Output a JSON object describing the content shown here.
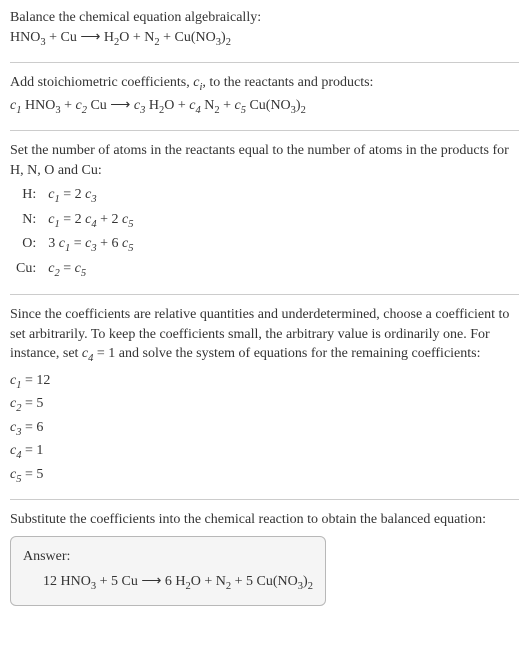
{
  "intro": {
    "line1": "Balance the chemical equation algebraically:",
    "eq_lhs1": "HNO",
    "eq_lhs1_sub": "3",
    "eq_plus1": " + Cu ⟶ H",
    "eq_sub2": "2",
    "eq_mid1": "O + N",
    "eq_sub3": "2",
    "eq_mid2": " + Cu(NO",
    "eq_sub4": "3",
    "eq_close": ")",
    "eq_sub5": "2"
  },
  "stoich": {
    "text_a": "Add stoichiometric coefficients, ",
    "ci": "c",
    "ci_sub": "i",
    "text_b": ", to the reactants and products:",
    "c1": "c",
    "c1s": "1",
    "sp1": " HNO",
    "s1": "3",
    "plus1": " + ",
    "c2": "c",
    "c2s": "2",
    "sp2": " Cu ⟶ ",
    "c3": "c",
    "c3s": "3",
    "sp3": " H",
    "s3": "2",
    "sp3b": "O + ",
    "c4": "c",
    "c4s": "4",
    "sp4": " N",
    "s4": "2",
    "sp4b": " + ",
    "c5": "c",
    "c5s": "5",
    "sp5": " Cu(NO",
    "s5": "3",
    "sp5b": ")",
    "s5c": "2"
  },
  "atoms": {
    "intro": "Set the number of atoms in the reactants equal to the number of atoms in the products for H, N, O and Cu:",
    "rows": [
      {
        "el": "H:",
        "lhs_c": "c",
        "lhs_s": "1",
        "mid": " = 2 ",
        "rhs_c": "c",
        "rhs_s": "3",
        "extra": ""
      },
      {
        "el": "N:",
        "lhs_c": "c",
        "lhs_s": "1",
        "mid": " = 2 ",
        "rhs_c": "c",
        "rhs_s": "4",
        "extra": " + 2 ",
        "rc2": "c",
        "rs2": "5"
      },
      {
        "el": "O:",
        "pre": "3 ",
        "lhs_c": "c",
        "lhs_s": "1",
        "mid": " = ",
        "rhs_c": "c",
        "rhs_s": "3",
        "extra": " + 6 ",
        "rc2": "c",
        "rs2": "5"
      },
      {
        "el": "Cu:",
        "lhs_c": "c",
        "lhs_s": "2",
        "mid": " = ",
        "rhs_c": "c",
        "rhs_s": "5",
        "extra": ""
      }
    ]
  },
  "choose": {
    "para_a": "Since the coefficients are relative quantities and underdetermined, choose a coefficient to set arbitrarily. To keep the coefficients small, the arbitrary value is ordinarily one. For instance, set ",
    "c4": "c",
    "c4s": "4",
    "para_b": " = 1 and solve the system of equations for the remaining coefficients:",
    "coefs": [
      {
        "c": "c",
        "s": "1",
        "v": " = 12"
      },
      {
        "c": "c",
        "s": "2",
        "v": " = 5"
      },
      {
        "c": "c",
        "s": "3",
        "v": " = 6"
      },
      {
        "c": "c",
        "s": "4",
        "v": " = 1"
      },
      {
        "c": "c",
        "s": "5",
        "v": " = 5"
      }
    ]
  },
  "subst": {
    "text": "Substitute the coefficients into the chemical reaction to obtain the balanced equation:"
  },
  "answer": {
    "label": "Answer:",
    "p1": "12 HNO",
    "s1": "3",
    "p2": " + 5 Cu ⟶ 6 H",
    "s2": "2",
    "p3": "O + N",
    "s3": "2",
    "p4": " + 5 Cu(NO",
    "s4": "3",
    "p5": ")",
    "s5": "2"
  }
}
